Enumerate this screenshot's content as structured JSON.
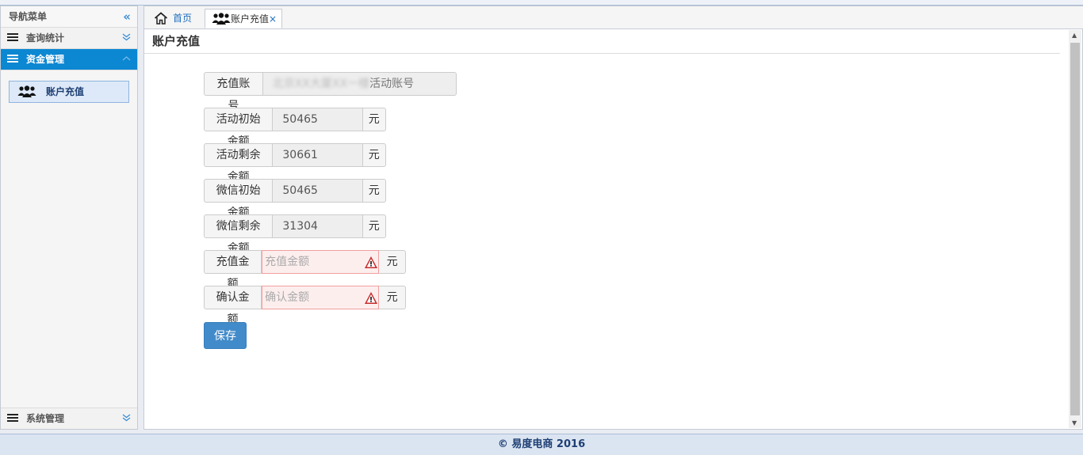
{
  "sidebar": {
    "title": "导航菜单",
    "collapse_glyph": "«",
    "sections": [
      {
        "label": "查询统计",
        "icon": "menu-list-icon"
      },
      {
        "label": "资金管理",
        "icon": "menu-list-icon"
      }
    ],
    "items": [
      {
        "label": "账户充值",
        "icon": "users-icon"
      }
    ],
    "bottom_section": {
      "label": "系统管理",
      "icon": "menu-list-icon"
    }
  },
  "tabs": [
    {
      "label": "首页",
      "icon": "home-icon"
    },
    {
      "label": "账户充值",
      "icon": "users-icon",
      "close": "×"
    }
  ],
  "page": {
    "title": "账户充值",
    "form": {
      "account": {
        "label": "充值账号",
        "value_blurred": "北京XX大厦XX一楼",
        "value_suffix": "活动账号"
      },
      "activity_initial": {
        "label": "活动初始金额",
        "value": "50465",
        "unit": "元"
      },
      "activity_remaining": {
        "label": "活动剩余金额",
        "value": "30661",
        "unit": "元"
      },
      "wechat_initial": {
        "label": "微信初始金额",
        "value": "50465",
        "unit": "元"
      },
      "wechat_remaining": {
        "label": "微信剩余金额",
        "value": "31304",
        "unit": "元"
      },
      "recharge_amount": {
        "label": "充值金额",
        "placeholder": "充值金额",
        "unit": "元"
      },
      "confirm_amount": {
        "label": "确认金额",
        "placeholder": "确认金额",
        "unit": "元"
      },
      "save_label": "保存"
    }
  },
  "footer": {
    "text": "© 易度电商 2016"
  },
  "colors": {
    "accent": "#0c87d2",
    "button": "#428bca",
    "error_bg": "#fdeeee",
    "footer_bg": "#dbe5f2"
  }
}
